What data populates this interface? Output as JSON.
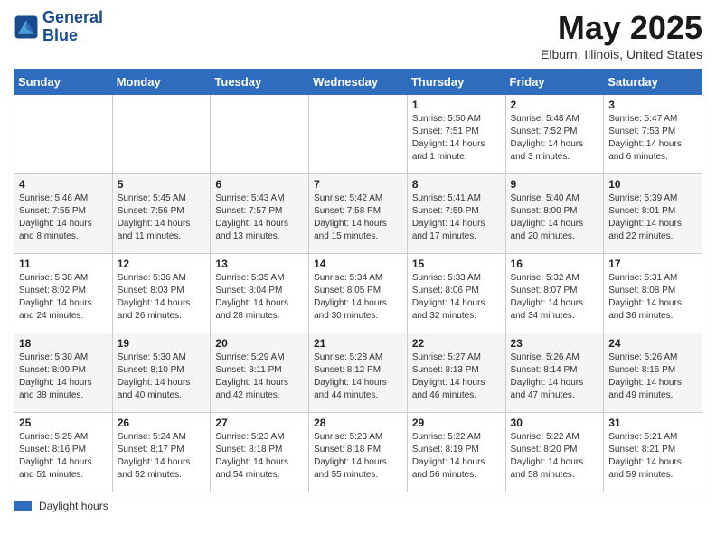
{
  "header": {
    "logo_line1": "General",
    "logo_line2": "Blue",
    "title": "May 2025",
    "subtitle": "Elburn, Illinois, United States"
  },
  "days_of_week": [
    "Sunday",
    "Monday",
    "Tuesday",
    "Wednesday",
    "Thursday",
    "Friday",
    "Saturday"
  ],
  "weeks": [
    [
      {
        "num": "",
        "info": ""
      },
      {
        "num": "",
        "info": ""
      },
      {
        "num": "",
        "info": ""
      },
      {
        "num": "",
        "info": ""
      },
      {
        "num": "1",
        "info": "Sunrise: 5:50 AM\nSunset: 7:51 PM\nDaylight: 14 hours\nand 1 minute."
      },
      {
        "num": "2",
        "info": "Sunrise: 5:48 AM\nSunset: 7:52 PM\nDaylight: 14 hours\nand 3 minutes."
      },
      {
        "num": "3",
        "info": "Sunrise: 5:47 AM\nSunset: 7:53 PM\nDaylight: 14 hours\nand 6 minutes."
      }
    ],
    [
      {
        "num": "4",
        "info": "Sunrise: 5:46 AM\nSunset: 7:55 PM\nDaylight: 14 hours\nand 8 minutes."
      },
      {
        "num": "5",
        "info": "Sunrise: 5:45 AM\nSunset: 7:56 PM\nDaylight: 14 hours\nand 11 minutes."
      },
      {
        "num": "6",
        "info": "Sunrise: 5:43 AM\nSunset: 7:57 PM\nDaylight: 14 hours\nand 13 minutes."
      },
      {
        "num": "7",
        "info": "Sunrise: 5:42 AM\nSunset: 7:58 PM\nDaylight: 14 hours\nand 15 minutes."
      },
      {
        "num": "8",
        "info": "Sunrise: 5:41 AM\nSunset: 7:59 PM\nDaylight: 14 hours\nand 17 minutes."
      },
      {
        "num": "9",
        "info": "Sunrise: 5:40 AM\nSunset: 8:00 PM\nDaylight: 14 hours\nand 20 minutes."
      },
      {
        "num": "10",
        "info": "Sunrise: 5:39 AM\nSunset: 8:01 PM\nDaylight: 14 hours\nand 22 minutes."
      }
    ],
    [
      {
        "num": "11",
        "info": "Sunrise: 5:38 AM\nSunset: 8:02 PM\nDaylight: 14 hours\nand 24 minutes."
      },
      {
        "num": "12",
        "info": "Sunrise: 5:36 AM\nSunset: 8:03 PM\nDaylight: 14 hours\nand 26 minutes."
      },
      {
        "num": "13",
        "info": "Sunrise: 5:35 AM\nSunset: 8:04 PM\nDaylight: 14 hours\nand 28 minutes."
      },
      {
        "num": "14",
        "info": "Sunrise: 5:34 AM\nSunset: 8:05 PM\nDaylight: 14 hours\nand 30 minutes."
      },
      {
        "num": "15",
        "info": "Sunrise: 5:33 AM\nSunset: 8:06 PM\nDaylight: 14 hours\nand 32 minutes."
      },
      {
        "num": "16",
        "info": "Sunrise: 5:32 AM\nSunset: 8:07 PM\nDaylight: 14 hours\nand 34 minutes."
      },
      {
        "num": "17",
        "info": "Sunrise: 5:31 AM\nSunset: 8:08 PM\nDaylight: 14 hours\nand 36 minutes."
      }
    ],
    [
      {
        "num": "18",
        "info": "Sunrise: 5:30 AM\nSunset: 8:09 PM\nDaylight: 14 hours\nand 38 minutes."
      },
      {
        "num": "19",
        "info": "Sunrise: 5:30 AM\nSunset: 8:10 PM\nDaylight: 14 hours\nand 40 minutes."
      },
      {
        "num": "20",
        "info": "Sunrise: 5:29 AM\nSunset: 8:11 PM\nDaylight: 14 hours\nand 42 minutes."
      },
      {
        "num": "21",
        "info": "Sunrise: 5:28 AM\nSunset: 8:12 PM\nDaylight: 14 hours\nand 44 minutes."
      },
      {
        "num": "22",
        "info": "Sunrise: 5:27 AM\nSunset: 8:13 PM\nDaylight: 14 hours\nand 46 minutes."
      },
      {
        "num": "23",
        "info": "Sunrise: 5:26 AM\nSunset: 8:14 PM\nDaylight: 14 hours\nand 47 minutes."
      },
      {
        "num": "24",
        "info": "Sunrise: 5:26 AM\nSunset: 8:15 PM\nDaylight: 14 hours\nand 49 minutes."
      }
    ],
    [
      {
        "num": "25",
        "info": "Sunrise: 5:25 AM\nSunset: 8:16 PM\nDaylight: 14 hours\nand 51 minutes."
      },
      {
        "num": "26",
        "info": "Sunrise: 5:24 AM\nSunset: 8:17 PM\nDaylight: 14 hours\nand 52 minutes."
      },
      {
        "num": "27",
        "info": "Sunrise: 5:23 AM\nSunset: 8:18 PM\nDaylight: 14 hours\nand 54 minutes."
      },
      {
        "num": "28",
        "info": "Sunrise: 5:23 AM\nSunset: 8:18 PM\nDaylight: 14 hours\nand 55 minutes."
      },
      {
        "num": "29",
        "info": "Sunrise: 5:22 AM\nSunset: 8:19 PM\nDaylight: 14 hours\nand 56 minutes."
      },
      {
        "num": "30",
        "info": "Sunrise: 5:22 AM\nSunset: 8:20 PM\nDaylight: 14 hours\nand 58 minutes."
      },
      {
        "num": "31",
        "info": "Sunrise: 5:21 AM\nSunset: 8:21 PM\nDaylight: 14 hours\nand 59 minutes."
      }
    ]
  ],
  "legend": {
    "color_label": "Daylight hours",
    "color": "#2e6dbe"
  }
}
